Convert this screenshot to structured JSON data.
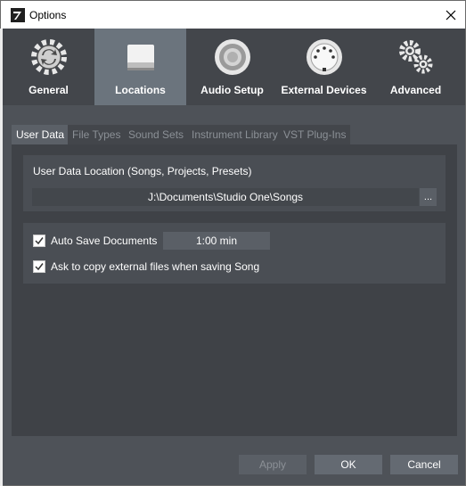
{
  "window": {
    "title": "Options"
  },
  "toolbar": {
    "items": [
      {
        "label": "General",
        "icon": "sync-gear-icon"
      },
      {
        "label": "Locations",
        "icon": "drive-icon",
        "active": true
      },
      {
        "label": "Audio Setup",
        "icon": "speaker-icon"
      },
      {
        "label": "External Devices",
        "icon": "midi-connector-icon"
      },
      {
        "label": "Advanced",
        "icon": "gears-icon"
      }
    ]
  },
  "tabs": [
    {
      "label": "User Data",
      "active": true
    },
    {
      "label": "File Types"
    },
    {
      "label": "Sound Sets"
    },
    {
      "label": "Instrument Library"
    },
    {
      "label": "VST Plug-Ins"
    }
  ],
  "user_data": {
    "location_label": "User Data Location (Songs, Projects, Presets)",
    "path": "J:\\Documents\\Studio One\\Songs",
    "browse_label": "..."
  },
  "options": {
    "auto_save_label": "Auto Save Documents",
    "auto_save_checked": true,
    "auto_save_interval": "1:00 min",
    "ask_copy_label": "Ask to copy external files when saving Song",
    "ask_copy_checked": true
  },
  "buttons": {
    "apply": "Apply",
    "ok": "OK",
    "cancel": "Cancel"
  },
  "colors": {
    "active_tab": "#6b747d",
    "panel": "#3f4247",
    "toolbar": "#43464b"
  }
}
